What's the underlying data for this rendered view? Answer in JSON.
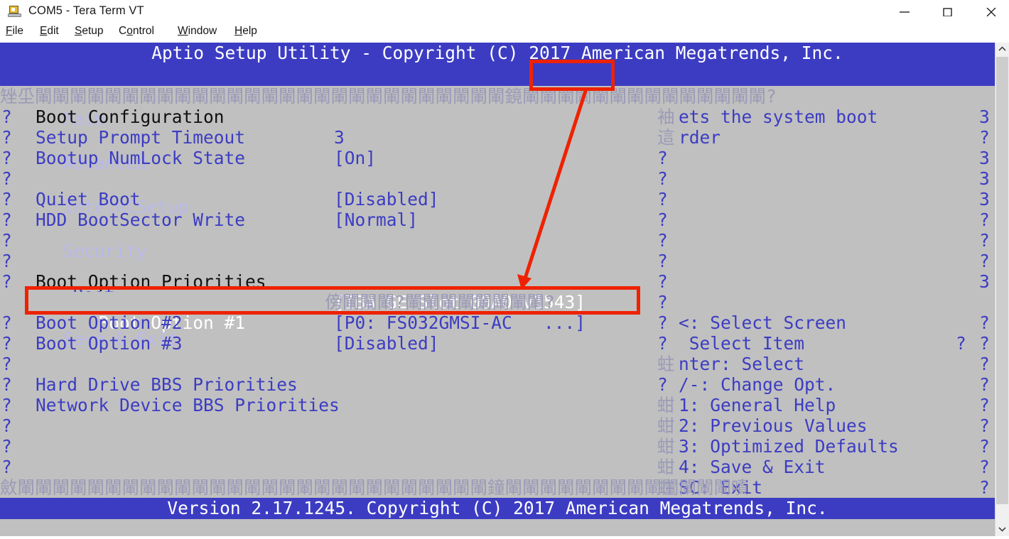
{
  "window": {
    "title": "COM5 - Tera Term VT",
    "icon": "terminal-laptop-icon",
    "minimize_label": "—",
    "maximize_label": "□",
    "close_label": "✕"
  },
  "menubar": {
    "items": [
      {
        "label": "File",
        "mnemonic": "F"
      },
      {
        "label": "Edit",
        "mnemonic": "E"
      },
      {
        "label": "Setup",
        "mnemonic": "S"
      },
      {
        "label": "Control",
        "mnemonic": "o"
      },
      {
        "label": "Window",
        "mnemonic": "W"
      },
      {
        "label": "Help",
        "mnemonic": "H"
      }
    ]
  },
  "bios": {
    "header_title": "Aptio Setup Utility - Copyright (C) 2017 American Megatrends, Inc.",
    "tabs": [
      {
        "label": "Main",
        "active": false
      },
      {
        "label": "Advanced",
        "active": false
      },
      {
        "label": "IntelRCSetup",
        "active": false
      },
      {
        "label": "Security",
        "active": false
      },
      {
        "label": "Boot",
        "active": true
      },
      {
        "label": "Save & Exit",
        "active": false
      }
    ],
    "border_top_left": "矬坕",
    "border_fill_char": "閳",
    "border_mid_char": "鏡",
    "border_bottom_left": "斂",
    "border_bottom_mid": "鐘",
    "border_bottom_right": "嘖",
    "border_right_char": "?",
    "left_edge_char": "?",
    "section_configuration": "Boot Configuration",
    "rows_configuration": [
      {
        "label": "Setup Prompt Timeout",
        "value": "3"
      },
      {
        "label": "Bootup NumLock State",
        "value": "[On]"
      },
      {
        "label": "",
        "value": ""
      },
      {
        "label": "Quiet Boot",
        "value": "[Disabled]"
      },
      {
        "label": "HDD BootSector Write",
        "value": "[Normal]"
      }
    ],
    "section_priorities": "Boot Option Priorities",
    "rows_priorities": [
      {
        "label": "Boot Option #1",
        "value": "[IBA GE Slot 00A0 v1543]",
        "selected": true
      },
      {
        "label": "Boot Option #2",
        "value": "[P0: FS032GMSI-AC   ...]",
        "selected": false
      },
      {
        "label": "Boot Option #3",
        "value": "[Disabled]",
        "selected": false
      }
    ],
    "submenus": [
      "Hard Drive BBS Priorities",
      "Network Device BBS Priorities"
    ],
    "help": {
      "line1_glyph": "袖",
      "line1_text": "ets the system boot",
      "line2_glyph": "這",
      "line2_text": "rder"
    },
    "keys": [
      {
        "glyph": "?",
        "text": "<: Select Screen"
      },
      {
        "glyph": "?",
        "text": " Select Item"
      },
      {
        "glyph": "蛀",
        "text": "nter: Select"
      },
      {
        "glyph": "?",
        "text": "/-: Change Opt."
      },
      {
        "glyph": "蚶",
        "text": "1: General Help"
      },
      {
        "glyph": "蚶",
        "text": "2: Previous Values"
      },
      {
        "glyph": "蚶",
        "text": "3: Optimized Defaults"
      },
      {
        "glyph": "蚶",
        "text": "4: Save & Exit"
      },
      {
        "glyph": "蛀",
        "text": "SC: Exit"
      }
    ],
    "right_column_chars": [
      "3",
      "?",
      "3",
      "3",
      "3",
      "?",
      "?",
      "?",
      "3"
    ],
    "right_column_chars2": [
      "?",
      "?",
      "?",
      "?",
      "?",
      "?",
      "?",
      "?",
      "?"
    ],
    "footer": "Version 2.17.1245. Copyright (C) 2017 American Megatrends, Inc."
  },
  "annotations": {
    "accent_color": "#ee2200",
    "box_tab": "Boot",
    "box_row": "Boot Option #1"
  },
  "colors": {
    "bios_blue": "#3c3cc3",
    "bios_gray": "#c0c0c0",
    "text_white": "#ffffff",
    "text_black": "#101010",
    "annotation_red": "#ee2200"
  }
}
